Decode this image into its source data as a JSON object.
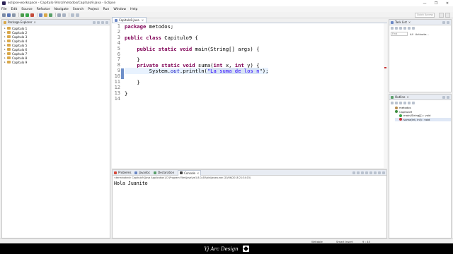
{
  "window": {
    "title": "eclipse-workspace - Capitulo 9/src/metodos/Capitulo9.java - Eclipse",
    "controls": [
      "—",
      "❐",
      "✕"
    ]
  },
  "menu": [
    "File",
    "Edit",
    "Source",
    "Refactor",
    "Navigate",
    "Search",
    "Project",
    "Run",
    "Window",
    "Help"
  ],
  "quick_access": {
    "placeholder": "Quick Access"
  },
  "package_explorer": {
    "title": "Package Explorer",
    "projects": [
      "Capitulo 1",
      "Capitulo 2",
      "Capitulo 3",
      "Capitulo 4",
      "Capitulo 5",
      "Capitulo 6",
      "Capitulo 7",
      "Capitulo 8",
      "Capitulo 9"
    ]
  },
  "editor": {
    "tab": "Capitulo9.java",
    "line_numbers": [
      "1",
      "2",
      "3",
      "4",
      "5",
      "6",
      "7",
      "8",
      "9",
      "10",
      "11",
      "12",
      "13",
      "14"
    ],
    "code": {
      "l1_kw": "package",
      "l1_rest": " metodos;",
      "l3_kw1": "public",
      "l3_kw2": "class",
      "l3_rest": " Capitulo9 {",
      "l5_kw1": "public",
      "l5_kw2": "static",
      "l5_kw3": "void",
      "l5_rest": " main(String[] args) {",
      "l7": "}",
      "l8_kw1": "private",
      "l8_kw2": "static",
      "l8_kw3": "void",
      "l8_m": " suma(",
      "l8_kw4": "int",
      "l8_p1": " x, ",
      "l8_kw5": "int",
      "l8_p2": " y) {",
      "l9_a": "System.",
      "l9_out": "out",
      "l9_b": ".println(",
      "l9_str": "\"La suma de los n",
      "l9_c": "\");",
      "l10": "}",
      "l12": "}"
    }
  },
  "bottom_panel": {
    "tabs": [
      "Problems",
      "Javadoc",
      "Declaration",
      "Console"
    ],
    "active_tab": "Console",
    "status": "<terminated> Capitulo9 [Java Application] C:\\Program Files\\Java\\jre1.8.0_60\\bin\\javaw.exe (20/06/2018 21:34:15)",
    "output": "Hola Juanito"
  },
  "task_list": {
    "title": "Task List",
    "find_placeholder": "Find",
    "filter_all": "All",
    "activate": "Activate..."
  },
  "outline": {
    "title": "Outline",
    "items": [
      "metodos",
      "Capitulo9",
      "main(String[]) : void",
      "suma(int, int) : void"
    ]
  },
  "status_bar": {
    "writable": "Writable",
    "insert_mode": "Smart Insert",
    "position": "9 : 45"
  },
  "watermark": {
    "text": "Yj Arc Design"
  },
  "colors": {
    "keyword": "#7f0055",
    "string": "#2a00ff",
    "field": "#0000c0"
  }
}
